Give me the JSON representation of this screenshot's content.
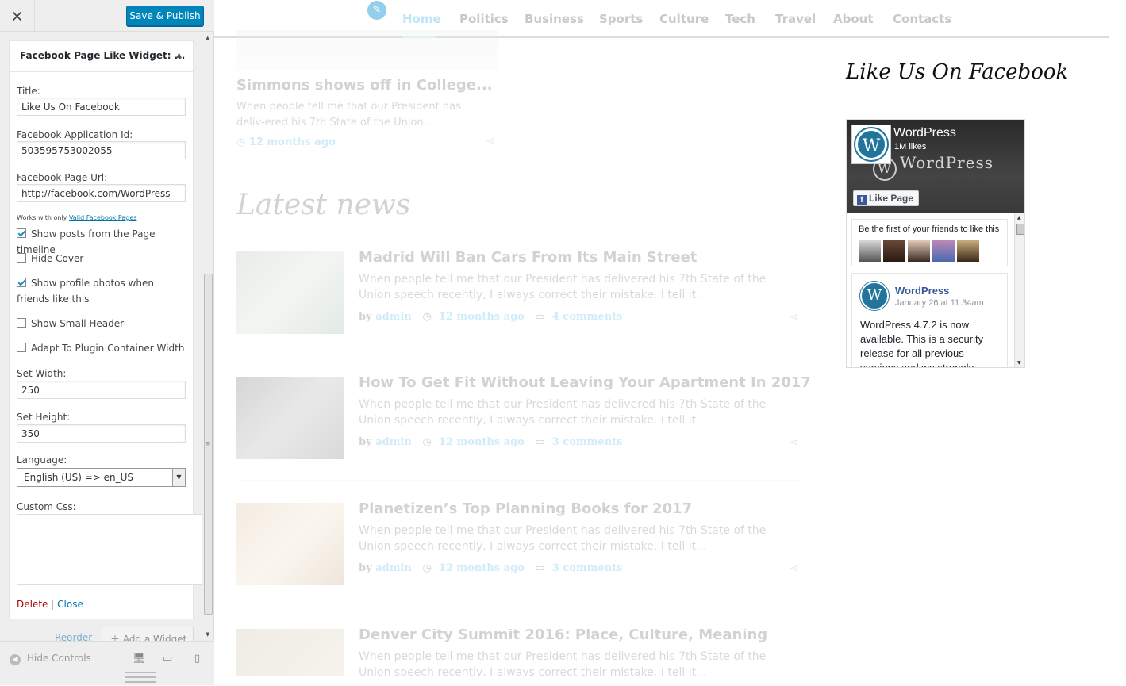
{
  "customizer": {
    "close_label": "×",
    "save_label": "Save & Publish",
    "widget": {
      "title": "Facebook Page Like Widget: ...",
      "fields": {
        "title_label": "Title:",
        "title_value": "Like Us On Facebook",
        "app_id_label": "Facebook Application Id:",
        "app_id_value": "503595753002055",
        "page_url_label": "Facebook Page Url:",
        "page_url_value": "http://facebook.com/WordPress",
        "note_prefix": "Works with only",
        "note_link": "Valid Facebook Pages",
        "show_posts_label": "Show posts from the Page timeline",
        "show_posts_checked": true,
        "hide_cover_label": "Hide Cover",
        "hide_cover_checked": false,
        "show_faces_label": "Show profile photos when friends like this",
        "show_faces_checked": true,
        "small_header_label": "Show Small Header",
        "small_header_checked": false,
        "adapt_width_label": "Adapt To Plugin Container Width",
        "adapt_width_checked": false,
        "width_label": "Set Width:",
        "width_value": "250",
        "height_label": "Set Height:",
        "height_value": "350",
        "language_label": "Language:",
        "language_value": "English (US) => en_US",
        "custom_css_label": "Custom Css:"
      },
      "delete_label": "Delete",
      "separator": "|",
      "close_label": "Close"
    },
    "reorder_label": "Reorder",
    "add_widget_label": "Add a Widget",
    "hide_controls_label": "Hide Controls"
  },
  "preview": {
    "nav": [
      "Home",
      "Politics",
      "Business",
      "Sports",
      "Culture",
      "Tech",
      "Travel",
      "About",
      "Contacts"
    ],
    "top_post": {
      "title": "Simmons shows off in College...",
      "excerpt": "When people tell me that our President has deliv-ered his 7th State of the Union...",
      "time": "12 months ago"
    },
    "latest_heading": "Latest news",
    "articles": [
      {
        "title": "Madrid Will Ban Cars From Its Main Street",
        "excerpt": "When people tell me that our President has delivered his 7th State of the Union speech recently, I always correct their mistake.  I tell it...",
        "by": "by",
        "author": "admin",
        "time": "12 months ago",
        "comments": "4 comments"
      },
      {
        "title": "How To Get Fit Without Leaving Your Apartment In 2017",
        "excerpt": "When people tell me that our President has delivered his 7th State of the Union speech recently, I always correct their mistake.  I tell it...",
        "by": "by",
        "author": "admin",
        "time": "12 months ago",
        "comments": "3 comments"
      },
      {
        "title": "Planetizen’s Top Planning Books for 2017",
        "excerpt": "When people tell me that our President has delivered his 7th State of the Union speech recently, I always correct their mistake.  I tell it...",
        "by": "by",
        "author": "admin",
        "time": "12 months ago",
        "comments": "3 comments"
      },
      {
        "title": "Denver City Summit 2016: Place, Culture, Meaning",
        "excerpt": "When people tell me that our President has delivered his 7th State of the Union speech recently, I always correct their mistake.  I tell it..."
      }
    ],
    "sidebar": {
      "heading": "Like Us On Facebook",
      "fb": {
        "page_name": "WordPress",
        "likes": "1M likes",
        "cover_text": "WordPress",
        "like_button": "Like Page",
        "friends_text": "Be the first of your friends to like this",
        "post_author": "WordPress",
        "post_date": "January 26 at 11:34am",
        "post_text": "WordPress 4.7.2 is now available. This is a security release for all previous versions and we strongly"
      }
    }
  },
  "colors": {
    "primary_button": "#0085ba",
    "link": "#0073aa",
    "delete": "#aa0000",
    "theme_accent": "#2aa7e1",
    "facebook_blue": "#3b5998"
  }
}
